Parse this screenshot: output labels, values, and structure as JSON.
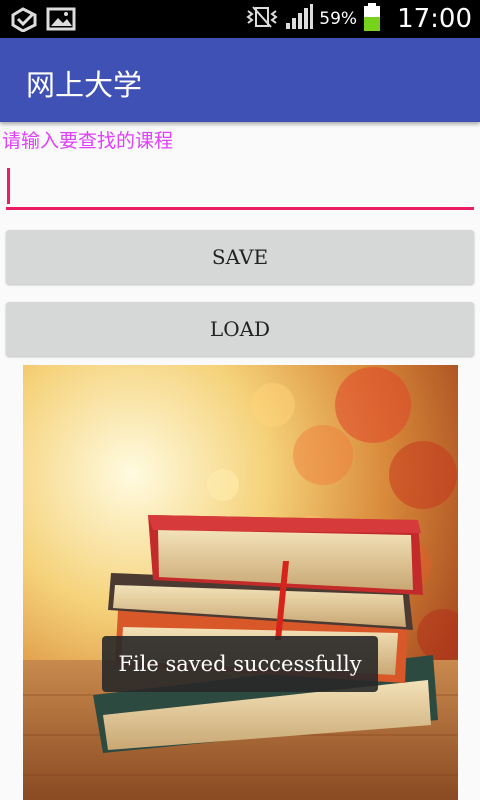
{
  "status_bar": {
    "battery_percent": "59%",
    "time": "17:00",
    "icons": [
      "app-notification-icon",
      "gallery-icon",
      "vibrate-icon",
      "signal-icon",
      "battery-icon"
    ]
  },
  "app_bar": {
    "title": "网上大学",
    "color": "#3f51b5"
  },
  "search": {
    "label": "请输入要查找的课程",
    "value": "",
    "accent": "#e91e63",
    "label_color": "#e040fb"
  },
  "buttons": {
    "save": "SAVE",
    "load": "LOAD"
  },
  "image": {
    "subject": "stack-of-books-photo"
  },
  "toast": {
    "message": "File saved successfully"
  }
}
